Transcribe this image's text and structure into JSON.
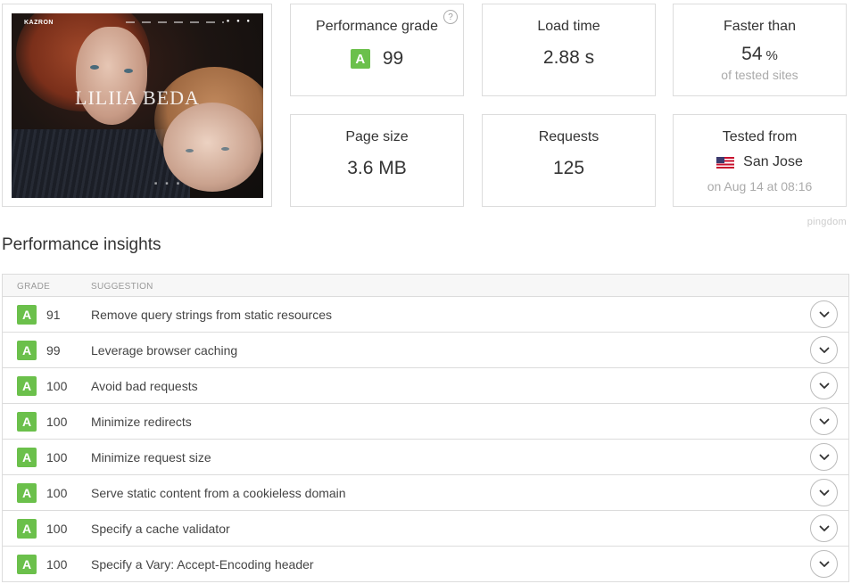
{
  "thumbnail": {
    "brand": "KAZRON",
    "headline": "LILIIA BEDA",
    "nav_icons": "● ● ●",
    "slider_dots": "■ ■ ■"
  },
  "stats": {
    "performance_grade": {
      "label": "Performance grade",
      "grade": "A",
      "value": "99",
      "help": "?"
    },
    "load_time": {
      "label": "Load time",
      "value": "2.88 s"
    },
    "faster_than": {
      "label": "Faster than",
      "value": "54",
      "unit": "%",
      "sub": "of tested sites"
    },
    "page_size": {
      "label": "Page size",
      "value": "3.6 MB"
    },
    "requests": {
      "label": "Requests",
      "value": "125"
    },
    "tested_from": {
      "label": "Tested from",
      "location": "San Jose",
      "flag": "us-flag-icon",
      "sub": "on Aug 14 at 08:16"
    }
  },
  "watermark": "pingdom",
  "insights": {
    "title": "Performance insights",
    "columns": {
      "grade": "GRADE",
      "suggestion": "SUGGESTION"
    },
    "rows": [
      {
        "grade": "A",
        "score": "91",
        "suggestion": "Remove query strings from static resources"
      },
      {
        "grade": "A",
        "score": "99",
        "suggestion": "Leverage browser caching"
      },
      {
        "grade": "A",
        "score": "100",
        "suggestion": "Avoid bad requests"
      },
      {
        "grade": "A",
        "score": "100",
        "suggestion": "Minimize redirects"
      },
      {
        "grade": "A",
        "score": "100",
        "suggestion": "Minimize request size"
      },
      {
        "grade": "A",
        "score": "100",
        "suggestion": "Serve static content from a cookieless domain"
      },
      {
        "grade": "A",
        "score": "100",
        "suggestion": "Specify a cache validator"
      },
      {
        "grade": "A",
        "score": "100",
        "suggestion": "Specify a Vary: Accept-Encoding header"
      }
    ]
  },
  "colors": {
    "grade_green": "#6bc04b",
    "border": "#dcdcdc",
    "muted": "#aaaaaa"
  }
}
